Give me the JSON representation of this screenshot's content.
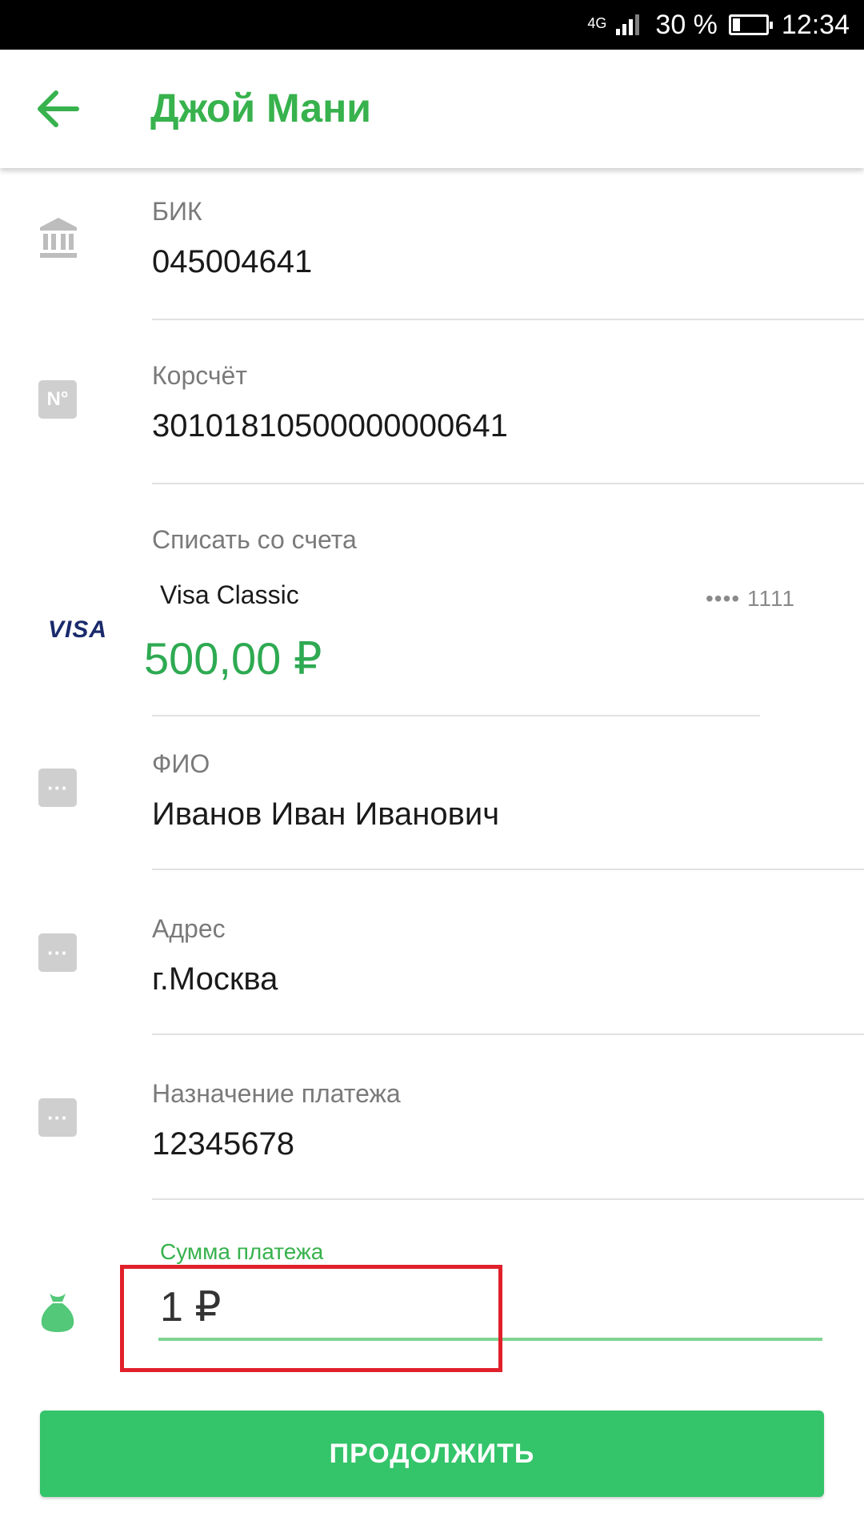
{
  "status_bar": {
    "network": "4G",
    "battery_text": "30 %",
    "time": "12:34"
  },
  "header": {
    "title": "Джой Мани",
    "back_icon": "arrow-left-icon",
    "accent_color": "#37b24d"
  },
  "fields": {
    "bik": {
      "label": "БИК",
      "value": "045004641",
      "icon": "bank-icon"
    },
    "corr_account": {
      "label": "Корсчёт",
      "value": "30101810500000000641",
      "icon": "number-sign-icon",
      "icon_text": "N°"
    },
    "debit_account": {
      "label": "Списать со счета",
      "card_brand": "VISA",
      "card_name": "Visa Classic",
      "card_mask": "•••• 1111",
      "balance": "500,00 ₽"
    },
    "full_name": {
      "label": "ФИО",
      "value": "Иванов Иван Иванович",
      "icon": "more-dots-icon",
      "icon_text": "···"
    },
    "address": {
      "label": "Адрес",
      "value": "г.Москва",
      "icon": "more-dots-icon",
      "icon_text": "···"
    },
    "purpose": {
      "label": "Назначение платежа",
      "value": "12345678",
      "icon": "more-dots-icon",
      "icon_text": "···"
    }
  },
  "amount": {
    "label": "Сумма платежа",
    "value": "1 ₽",
    "icon": "money-bag-icon"
  },
  "continue_button": {
    "label": "ПРОДОЛЖИТЬ",
    "color": "#34c46a"
  },
  "highlight_color": "#e0202a"
}
